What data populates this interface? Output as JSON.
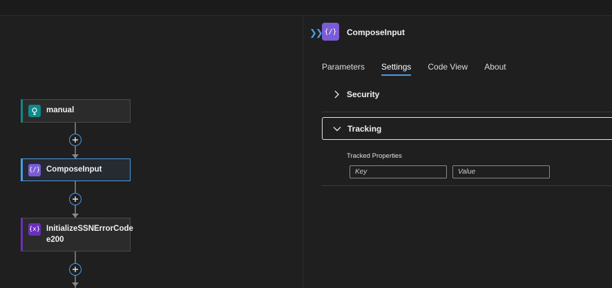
{
  "workflow": {
    "nodes": [
      {
        "label": "manual",
        "icon": "request-trigger-icon",
        "color": "#0e8a8a"
      },
      {
        "label": "ComposeInput",
        "icon": "compose-icon",
        "color": "#7b5cd6",
        "selected": true
      },
      {
        "label": "InitializeSSNErrorCode\ne200",
        "icon": "variable-icon",
        "color": "#6b2fbf"
      }
    ]
  },
  "panel": {
    "title": "ComposeInput",
    "action_icon_glyph": "{⁄}",
    "tabs": [
      "Parameters",
      "Settings",
      "Code View",
      "About"
    ],
    "active_tab": "Settings",
    "sections": {
      "security": {
        "label": "Security",
        "expanded": false
      },
      "tracking": {
        "label": "Tracking",
        "expanded": true
      }
    },
    "tracked_properties": {
      "label": "Tracked Properties",
      "key_placeholder": "Key",
      "value_placeholder": "Value"
    }
  },
  "colors": {
    "accent": "#4a9be8",
    "compose": "#7b5cd6",
    "trigger": "#0e8a8a",
    "variable": "#6b2fbf"
  }
}
